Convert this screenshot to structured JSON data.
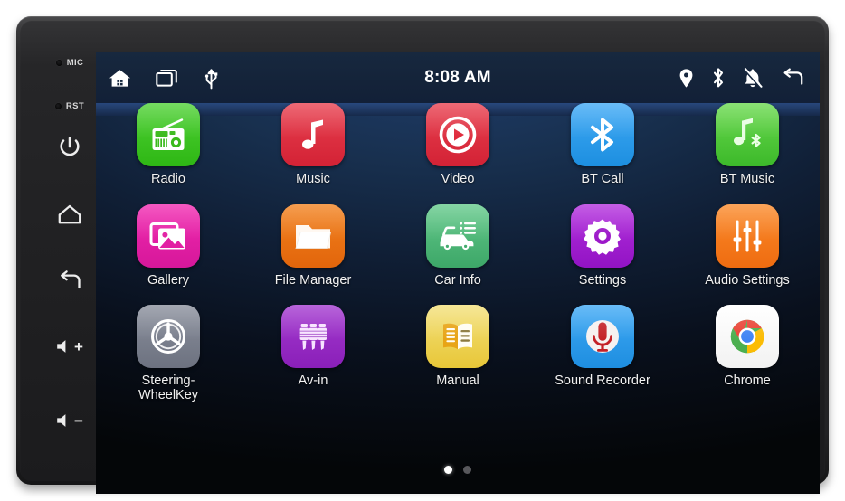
{
  "device": {
    "side_buttons": [
      {
        "name": "mic-indicator",
        "label": "MIC",
        "type": "led"
      },
      {
        "name": "reset-indicator",
        "label": "RST",
        "type": "led"
      },
      {
        "name": "power-button",
        "label": "",
        "type": "icon",
        "icon": "power-icon"
      },
      {
        "name": "home-button",
        "label": "",
        "type": "icon",
        "icon": "home-icon"
      },
      {
        "name": "back-button",
        "label": "",
        "type": "icon",
        "icon": "back-arrow-icon"
      },
      {
        "name": "volume-up-button",
        "label": "+",
        "type": "volume",
        "icon": "speaker-icon"
      },
      {
        "name": "volume-down-button",
        "label": "−",
        "type": "volume",
        "icon": "speaker-icon"
      }
    ]
  },
  "statusbar": {
    "clock": "8:08 AM",
    "left_icons": [
      {
        "name": "home-icon",
        "title": "Home"
      },
      {
        "name": "recents-icon",
        "title": "Recent apps"
      },
      {
        "name": "usb-icon",
        "title": "USB"
      }
    ],
    "right_icons": [
      {
        "name": "location-pin-icon",
        "title": "Location"
      },
      {
        "name": "bluetooth-icon",
        "title": "Bluetooth"
      },
      {
        "name": "notifications-muted-icon",
        "title": "Notifications muted"
      },
      {
        "name": "back-arrow-icon",
        "title": "Back"
      }
    ]
  },
  "home": {
    "rows": [
      [
        {
          "label": "Radio",
          "icon": "radio-icon",
          "color": "#3ec71f",
          "tile": "t-green"
        },
        {
          "label": "Music",
          "icon": "music-note-icon",
          "color": "#d9283a",
          "tile": "t-red"
        },
        {
          "label": "Video",
          "icon": "video-play-icon",
          "color": "#d9283a",
          "tile": "t-red"
        },
        {
          "label": "BT Call",
          "icon": "bluetooth-icon",
          "color": "#2b99e8",
          "tile": "t-blue"
        },
        {
          "label": "BT Music",
          "icon": "bluetooth-music-icon",
          "color": "#4ec62f",
          "tile": "t-btgreen"
        }
      ],
      [
        {
          "label": "Gallery",
          "icon": "photo-icon",
          "color": "#e21fa3",
          "tile": "t-pink"
        },
        {
          "label": "File Manager",
          "icon": "folder-icon",
          "color": "#e86f10",
          "tile": "t-orange"
        },
        {
          "label": "Car Info",
          "icon": "car-info-icon",
          "color": "#4bb275",
          "tile": "t-cargreen"
        },
        {
          "label": "Settings",
          "icon": "gear-icon",
          "color": "#9c18c9",
          "tile": "t-purple"
        },
        {
          "label": "Audio Settings",
          "icon": "equalizer-icon",
          "color": "#f27518",
          "tile": "t-orange2"
        }
      ],
      [
        {
          "label": "Steering-\nWheelKey",
          "icon": "steering-wheel-icon",
          "color": "#767b88",
          "tile": "t-slate"
        },
        {
          "label": "Av-in",
          "icon": "rca-plugs-icon",
          "color": "#9424c1",
          "tile": "t-purple2"
        },
        {
          "label": "Manual",
          "icon": "open-book-icon",
          "color": "#ecc93f",
          "tile": "t-gold"
        },
        {
          "label": "Sound Recorder",
          "icon": "microphone-icon",
          "color": "#2b99e8",
          "tile": "t-recblue"
        },
        {
          "label": "Chrome",
          "icon": "chrome-icon",
          "color": "#ffffff",
          "tile": "t-white"
        }
      ]
    ],
    "page_dots": {
      "count": 2,
      "active_index": 0
    }
  },
  "theme": {
    "screen_bg_top": "#203e6e",
    "screen_bg_bottom": "#040608",
    "statusbar_bg": "#17283f",
    "label_color": "#f2f2f2"
  }
}
